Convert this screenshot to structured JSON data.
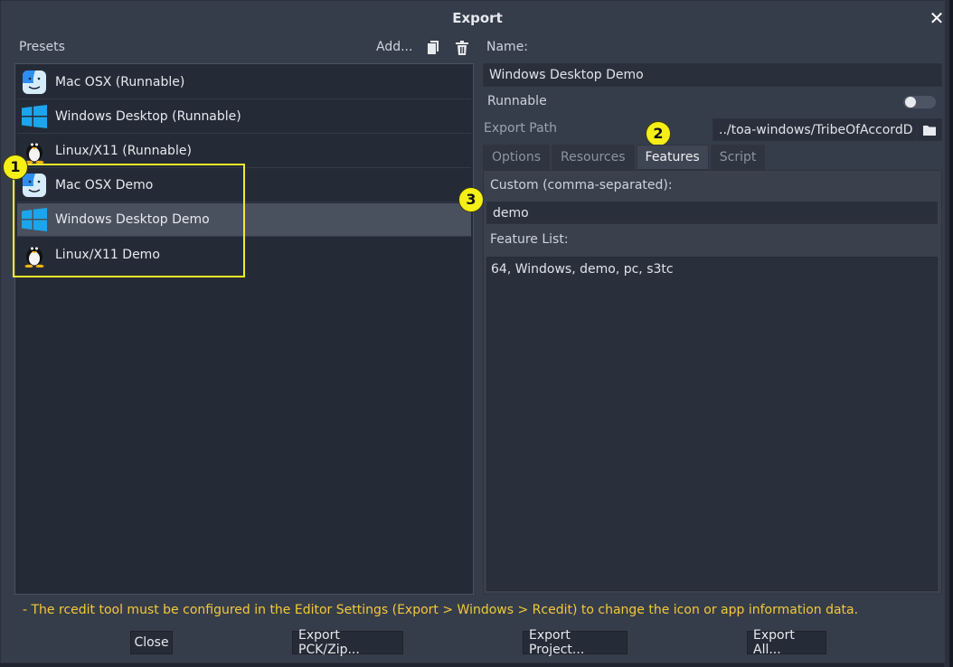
{
  "dialog": {
    "title": "Export"
  },
  "presets": {
    "label": "Presets",
    "add_label": "Add...",
    "items": [
      {
        "label": "Mac OSX (Runnable)",
        "icon": "macos-finder-icon"
      },
      {
        "label": "Windows Desktop (Runnable)",
        "icon": "windows-icon"
      },
      {
        "label": "Linux/X11 (Runnable)",
        "icon": "linux-tux-icon"
      },
      {
        "label": "Mac OSX Demo",
        "icon": "macos-finder-icon"
      },
      {
        "label": "Windows Desktop Demo",
        "icon": "windows-icon",
        "selected": true
      },
      {
        "label": "Linux/X11 Demo",
        "icon": "linux-tux-icon"
      }
    ]
  },
  "form": {
    "name_label": "Name:",
    "name_value": "Windows Desktop Demo",
    "runnable_label": "Runnable",
    "runnable_on": false,
    "export_path_label": "Export Path",
    "export_path_value": "../toa-windows/TribeOfAccordD"
  },
  "tabs": [
    {
      "label": "Options",
      "active": false
    },
    {
      "label": "Resources",
      "active": false
    },
    {
      "label": "Features",
      "active": true
    },
    {
      "label": "Script",
      "active": false
    }
  ],
  "features": {
    "custom_label": "Custom (comma-separated):",
    "custom_value": "demo",
    "list_label": "Feature List:",
    "list_value": "64, Windows, demo, pc, s3tc"
  },
  "annotations": {
    "one": "1",
    "two": "2",
    "three": "3"
  },
  "warning": "- The rcedit tool must be configured in the Editor Settings (Export > Windows > Rcedit) to change the icon or app information data.",
  "buttons": {
    "close": "Close",
    "export_pck": "Export PCK/Zip...",
    "export_project": "Export Project...",
    "export_all": "Export All..."
  },
  "colors": {
    "dialog_bg": "#363d4a",
    "list_bg": "#252b36",
    "selected_row": "#4a515e",
    "highlight": "#f0ea2a",
    "warning": "#f3c83a",
    "windows_blue": "#1aa6ee"
  }
}
